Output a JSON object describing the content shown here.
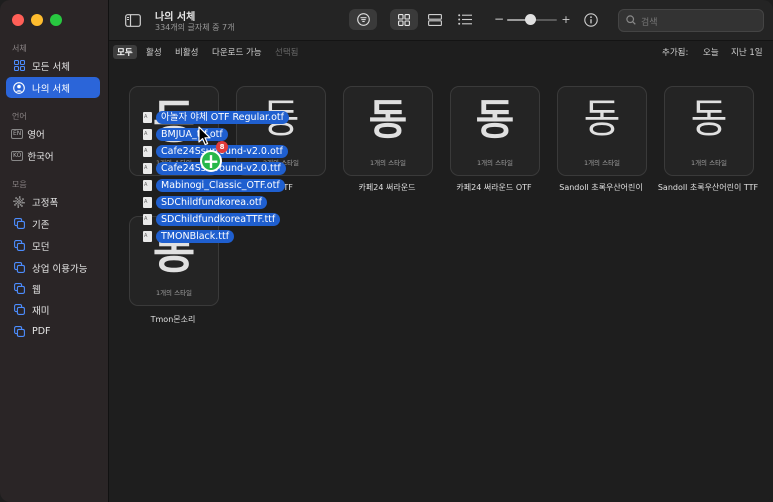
{
  "sidebar": {
    "sections": {
      "library": "서체",
      "language": "언어",
      "collection": "모음"
    },
    "items": {
      "all_fonts": "모든 서체",
      "my_fonts": "나의 서체",
      "english": "영어",
      "korean": "한국어",
      "favorites": "고정폭",
      "basic": "기존",
      "modern": "모던",
      "commercial": "상업 이용가능",
      "web": "웹",
      "fun": "재미",
      "pdf": "PDF"
    },
    "badges": {
      "en": "EN",
      "ko": "KO"
    }
  },
  "toolbar": {
    "title": "나의 서체",
    "subtitle": "334개의 글자체 중 7개",
    "search_placeholder": "검색",
    "zoom_minus": "−",
    "zoom_plus": "+",
    "zoom_level": 0.45
  },
  "filters": {
    "all": "모두",
    "active": "활성",
    "inactive": "비활성",
    "downloadable": "다운로드 가능",
    "selected": "선택됨",
    "added_label": "추가됨:",
    "today": "오늘",
    "last_week": "지난 1일"
  },
  "fonts": [
    {
      "glyph": "동",
      "styles": "1개의 스타일",
      "name": ""
    },
    {
      "glyph": "동",
      "styles": "2개의 스타일",
      "name": "체 OTF"
    },
    {
      "glyph": "동",
      "styles": "1개의 스타일",
      "name": "카페24 써라운드"
    },
    {
      "glyph": "동",
      "styles": "1개의 스타일",
      "name": "카페24 써라운드 OTF"
    },
    {
      "glyph": "동",
      "styles": "1개의 스타일",
      "name": "Sandoll 초록우산어린이"
    },
    {
      "glyph": "동",
      "styles": "1개의 스타일",
      "name": "Sandoll 초록우산어린이 TTF"
    },
    {
      "glyph": "동",
      "styles": "1개의 스타일",
      "name": "Tmon몬소리"
    }
  ],
  "drag": {
    "files": [
      "아놀자 야체 OTF Regular.otf",
      "BMJUA_ttf.otf",
      "Cafe24Ssurround-v2.0.otf",
      "Cafe24Ssurround-v2.0.ttf",
      "Mabinogi_Classic_OTF.otf",
      "SDChildfundkorea.otf",
      "SDChildfundkoreaTTF.ttf",
      "TMONBlack.ttf"
    ],
    "count": "8",
    "file_icon_text": "A"
  },
  "colors": {
    "accent": "#2b65d9",
    "drag_label": "#1f5fcf",
    "add_badge": "#28b84a",
    "count_badge": "#e03b3b"
  }
}
